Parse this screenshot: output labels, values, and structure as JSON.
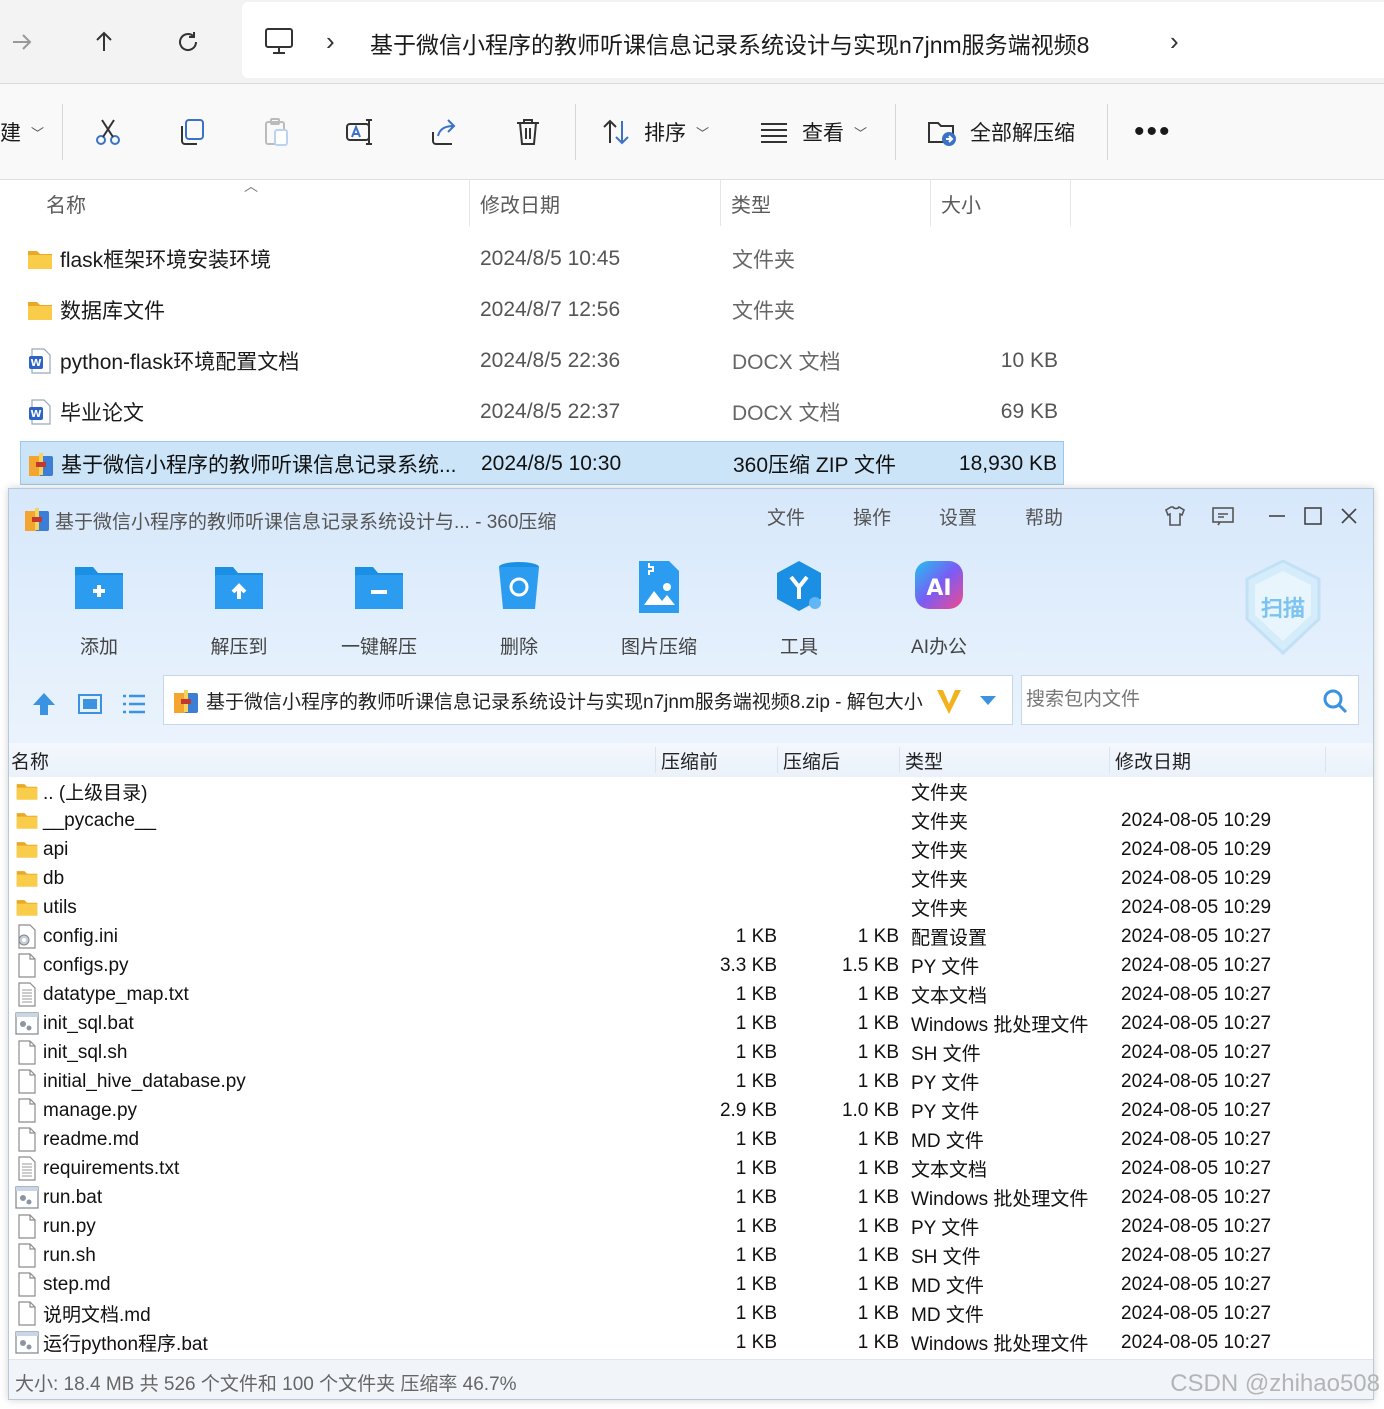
{
  "explorer": {
    "address_path": "基于微信小程序的教师听课信息记录系统设计与实现n7jnm服务端视频8",
    "command_bar": {
      "new_label_partial": "建",
      "sort_label": "排序",
      "view_label": "查看",
      "extract_all_label": "全部解压缩"
    },
    "columns": {
      "name": "名称",
      "modified": "修改日期",
      "type": "类型",
      "size": "大小"
    },
    "rows": [
      {
        "name": "flask框架环境安装环境",
        "modified": "2024/8/5 10:45",
        "type": "文件夹",
        "size": "",
        "icon": "folder-icon"
      },
      {
        "name": "数据库文件",
        "modified": "2024/8/7 12:56",
        "type": "文件夹",
        "size": "",
        "icon": "folder-icon"
      },
      {
        "name": "python-flask环境配置文档",
        "modified": "2024/8/5 22:36",
        "type": "DOCX 文档",
        "size": "10 KB",
        "icon": "word-doc-icon"
      },
      {
        "name": "毕业论文",
        "modified": "2024/8/5 22:37",
        "type": "DOCX 文档",
        "size": "69 KB",
        "icon": "word-doc-icon"
      },
      {
        "name": "基于微信小程序的教师听课信息记录系统...",
        "modified": "2024/8/5 10:30",
        "type": "360压缩 ZIP 文件",
        "size": "18,930 KB",
        "icon": "zip-archive-icon",
        "selected": true
      }
    ]
  },
  "archiver": {
    "title": "基于微信小程序的教师听课信息记录系统设计与... - 360压缩",
    "menu": [
      "文件",
      "操作",
      "设置",
      "帮助"
    ],
    "tools": [
      {
        "label": "添加",
        "icon": "add-to-archive-icon"
      },
      {
        "label": "解压到",
        "icon": "extract-to-icon"
      },
      {
        "label": "一键解压",
        "icon": "one-click-extract-icon"
      },
      {
        "label": "删除",
        "icon": "recycle-bin-icon"
      },
      {
        "label": "图片压缩",
        "icon": "image-compress-icon"
      },
      {
        "label": "工具",
        "icon": "tools-icon"
      },
      {
        "label": "AI办公",
        "icon": "ai-office-icon"
      }
    ],
    "scan_label": "扫描",
    "path_text": "基于微信小程序的教师听课信息记录系统设计与实现n7jnm服务端视频8.zip - 解包大小",
    "search_placeholder": "搜索包内文件",
    "columns": {
      "name": "名称",
      "before": "压缩前",
      "after": "压缩后",
      "type": "类型",
      "modified": "修改日期"
    },
    "files": [
      {
        "name": ".. (上级目录)",
        "before": "",
        "after": "",
        "type": "文件夹",
        "modified": "",
        "icon": "folder-icon"
      },
      {
        "name": "__pycache__",
        "before": "",
        "after": "",
        "type": "文件夹",
        "modified": "2024-08-05 10:29",
        "icon": "folder-icon"
      },
      {
        "name": "api",
        "before": "",
        "after": "",
        "type": "文件夹",
        "modified": "2024-08-05 10:29",
        "icon": "folder-icon"
      },
      {
        "name": "db",
        "before": "",
        "after": "",
        "type": "文件夹",
        "modified": "2024-08-05 10:29",
        "icon": "folder-icon"
      },
      {
        "name": "utils",
        "before": "",
        "after": "",
        "type": "文件夹",
        "modified": "2024-08-05 10:29",
        "icon": "folder-icon"
      },
      {
        "name": "config.ini",
        "before": "1 KB",
        "after": "1 KB",
        "type": "配置设置",
        "modified": "2024-08-05 10:27",
        "icon": "settings-file-icon"
      },
      {
        "name": "configs.py",
        "before": "3.3 KB",
        "after": "1.5 KB",
        "type": "PY 文件",
        "modified": "2024-08-05 10:27",
        "icon": "blank-file-icon"
      },
      {
        "name": "datatype_map.txt",
        "before": "1 KB",
        "after": "1 KB",
        "type": "文本文档",
        "modified": "2024-08-05 10:27",
        "icon": "text-file-icon"
      },
      {
        "name": "init_sql.bat",
        "before": "1 KB",
        "after": "1 KB",
        "type": "Windows 批处理文件",
        "modified": "2024-08-05 10:27",
        "icon": "batch-file-icon"
      },
      {
        "name": "init_sql.sh",
        "before": "1 KB",
        "after": "1 KB",
        "type": "SH 文件",
        "modified": "2024-08-05 10:27",
        "icon": "blank-file-icon"
      },
      {
        "name": "initial_hive_database.py",
        "before": "1 KB",
        "after": "1 KB",
        "type": "PY 文件",
        "modified": "2024-08-05 10:27",
        "icon": "blank-file-icon"
      },
      {
        "name": "manage.py",
        "before": "2.9 KB",
        "after": "1.0 KB",
        "type": "PY 文件",
        "modified": "2024-08-05 10:27",
        "icon": "blank-file-icon"
      },
      {
        "name": "readme.md",
        "before": "1 KB",
        "after": "1 KB",
        "type": "MD 文件",
        "modified": "2024-08-05 10:27",
        "icon": "blank-file-icon"
      },
      {
        "name": "requirements.txt",
        "before": "1 KB",
        "after": "1 KB",
        "type": "文本文档",
        "modified": "2024-08-05 10:27",
        "icon": "text-file-icon"
      },
      {
        "name": "run.bat",
        "before": "1 KB",
        "after": "1 KB",
        "type": "Windows 批处理文件",
        "modified": "2024-08-05 10:27",
        "icon": "batch-file-icon"
      },
      {
        "name": "run.py",
        "before": "1 KB",
        "after": "1 KB",
        "type": "PY 文件",
        "modified": "2024-08-05 10:27",
        "icon": "blank-file-icon"
      },
      {
        "name": "run.sh",
        "before": "1 KB",
        "after": "1 KB",
        "type": "SH 文件",
        "modified": "2024-08-05 10:27",
        "icon": "blank-file-icon"
      },
      {
        "name": "step.md",
        "before": "1 KB",
        "after": "1 KB",
        "type": "MD 文件",
        "modified": "2024-08-05 10:27",
        "icon": "blank-file-icon"
      },
      {
        "name": "说明文档.md",
        "before": "1 KB",
        "after": "1 KB",
        "type": "MD 文件",
        "modified": "2024-08-05 10:27",
        "icon": "blank-file-icon"
      },
      {
        "name": "运行python程序.bat",
        "before": "1 KB",
        "after": "1 KB",
        "type": "Windows 批处理文件",
        "modified": "2024-08-05 10:27",
        "icon": "batch-file-icon"
      }
    ],
    "status": "大小: 18.4 MB 共 526 个文件和 100 个文件夹 压缩率 46.7%"
  },
  "watermark": "CSDN @zhihao508",
  "colors": {
    "selection": "#cce4f7",
    "archiver_accent": "#1a8fe3",
    "folder": "#f5c342"
  }
}
